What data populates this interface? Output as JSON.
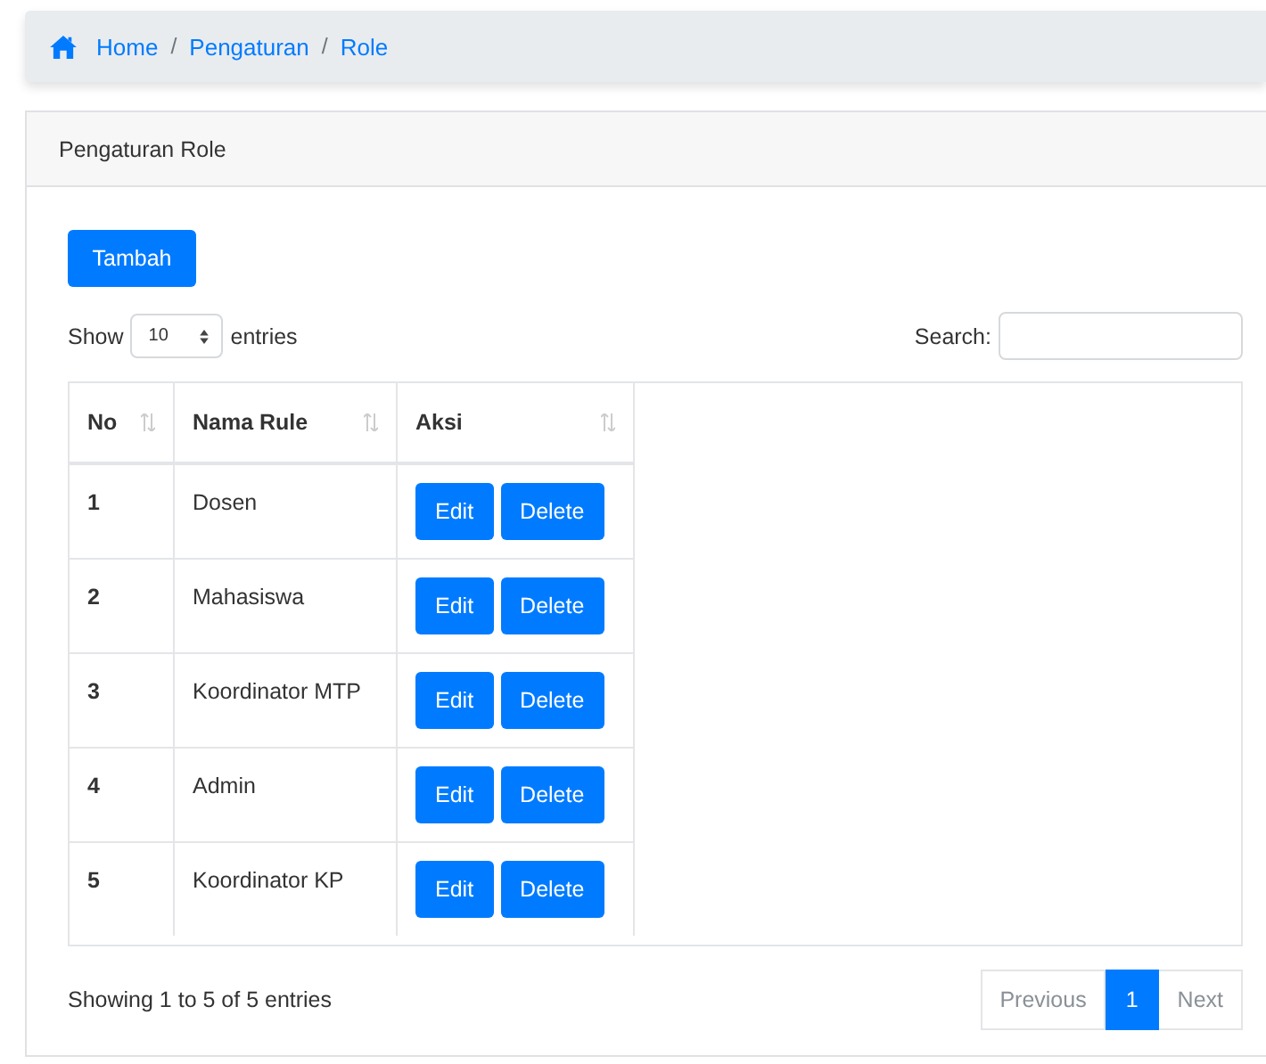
{
  "breadcrumb": [
    {
      "kind": "home",
      "label": "Home"
    },
    {
      "kind": "separator",
      "label": "/"
    },
    {
      "kind": "link",
      "label": "Pengaturan"
    },
    {
      "kind": "separator",
      "label": "/"
    },
    {
      "kind": "link",
      "label": "Role"
    }
  ],
  "card": {
    "title": "Pengaturan Role",
    "add_button": "Tambah",
    "length": {
      "before": "Show",
      "value": "10",
      "after": "entries"
    },
    "search": {
      "label": "Search:"
    },
    "table": {
      "columns": [
        "No",
        "Nama Rule",
        "Aksi"
      ],
      "rows": [
        {
          "no": "1",
          "name": "Dosen",
          "actions": [
            "Edit",
            "Delete"
          ]
        },
        {
          "no": "2",
          "name": "Mahasiswa",
          "actions": [
            "Edit",
            "Delete"
          ]
        },
        {
          "no": "3",
          "name": "Koordinator MTP",
          "actions": [
            "Edit",
            "Delete"
          ]
        },
        {
          "no": "4",
          "name": "Admin",
          "actions": [
            "Edit",
            "Delete"
          ]
        },
        {
          "no": "5",
          "name": "Koordinator KP",
          "actions": [
            "Edit",
            "Delete"
          ]
        }
      ]
    },
    "info": "Showing 1 to 5 of 5 entries",
    "pagination": [
      {
        "label": "Previous",
        "kind": "nav",
        "disabled": true,
        "selected": false
      },
      {
        "label": "1",
        "kind": "page",
        "disabled": false,
        "selected": true
      },
      {
        "label": "Next",
        "kind": "nav",
        "disabled": true,
        "selected": false
      }
    ]
  }
}
